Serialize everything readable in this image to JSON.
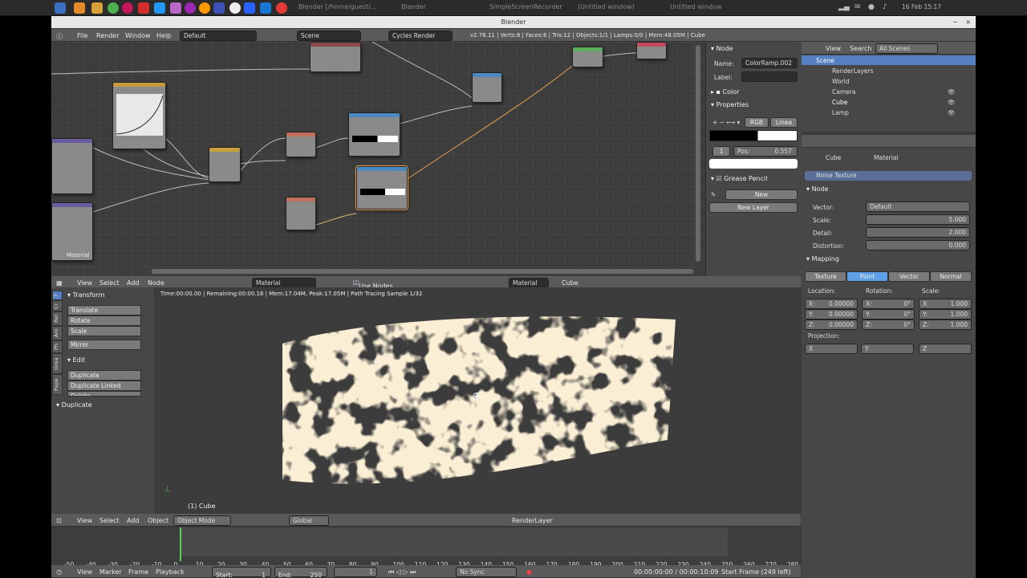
{
  "taskbar": {
    "tasks": [
      "Blender [/home/guest/...",
      "Blender",
      "SimpleScreenRecorder",
      "(Untitled window)",
      "Untitled window"
    ],
    "clock": "16 Feb 15:17"
  },
  "window": {
    "title": "Blender"
  },
  "infobar": {
    "menus": [
      "File",
      "Render",
      "Window",
      "Help"
    ],
    "layout": "Default",
    "scene": "Scene",
    "engine": "Cycles Render",
    "stats": "v2.76.11 | Verts:8 | Faces:6 | Tris:12 | Objects:1/1 | Lamps:0/0 | Mem:48.05M | Cube"
  },
  "node_editor": {
    "header_menus": [
      "View",
      "Select",
      "Add",
      "Node"
    ],
    "material": "Material",
    "use_nodes_label": "Use Nodes",
    "object": "Cube",
    "material_mode": "Material",
    "corner_label": "Material"
  },
  "node_panel": {
    "section_node": "Node",
    "name_label": "Name:",
    "name_value": "ColorRamp.002",
    "label_label": "Label:",
    "section_color": "Color",
    "section_properties": "Properties",
    "mode": "RGB",
    "interp": "Linea",
    "stop_index": "1",
    "pos_label": "Pos:",
    "pos_value": "0.557",
    "section_grease": "Grease Pencil",
    "new_label": "New",
    "new_layer_label": "New Layer"
  },
  "toolshelf": {
    "tabs": [
      "T",
      "Cr",
      "Rel",
      "Ani",
      "Ph",
      "Grea",
      "Pape"
    ],
    "section_transform": "Transform",
    "transform_items": [
      "Translate",
      "Rotate",
      "Scale"
    ],
    "mirror": "Mirror",
    "section_edit": "Edit",
    "edit_items": [
      "Duplicate",
      "Duplicate Linked",
      "Delete"
    ],
    "section_duplicate": "Duplicate"
  },
  "viewport": {
    "render_info": "Time:00:00.00 | Remaining:00:00.16 | Mem:17.04M, Peak:17.05M | Path Tracing Sample 1/32",
    "object_label": "(1) Cube",
    "header_menus": [
      "View",
      "Select",
      "Add",
      "Object"
    ],
    "mode": "Object Mode",
    "orientation": "Global",
    "render_layer": "RenderLayer"
  },
  "timeline": {
    "ticks": [
      "-50",
      "-40",
      "-30",
      "-20",
      "-10",
      "0",
      "10",
      "20",
      "30",
      "40",
      "50",
      "60",
      "70",
      "80",
      "90",
      "100",
      "110",
      "120",
      "130",
      "140",
      "150",
      "160",
      "170",
      "180",
      "190",
      "200",
      "210",
      "220",
      "230",
      "240",
      "250",
      "260",
      "270",
      "280"
    ],
    "menus": [
      "View",
      "Marker",
      "Frame",
      "Playback"
    ],
    "start_label": "Start:",
    "start": "1",
    "end_label": "End:",
    "end": "250",
    "current": "1",
    "sync": "No Sync",
    "time": "00:00:00:00 / 00:00:10:09",
    "status": "Start Frame (249 left)"
  },
  "outliner": {
    "menus": [
      "View",
      "Search"
    ],
    "filter": "All Scenes",
    "items": [
      "Scene",
      "RenderLayers",
      "World",
      "Camera",
      "Cube",
      "Lamp"
    ]
  },
  "properties": {
    "breadcrumb_object": "Cube",
    "breadcrumb_material": "Material",
    "texture_name": "Noise Texture",
    "section_node": "Node",
    "vector_label": "Vector:",
    "vector_value": "Default",
    "scale_label": "Scale:",
    "scale_value": "5.000",
    "detail_label": "Detail:",
    "detail_value": "2.000",
    "distortion_label": "Distortion:",
    "distortion_value": "0.000",
    "section_mapping": "Mapping",
    "mapping_tabs": [
      "Texture",
      "Point",
      "Vector",
      "Normal"
    ],
    "location_label": "Location:",
    "rotation_label": "Rotation:",
    "scale2_label": "Scale:",
    "loc": [
      "X:",
      "0.00000",
      "Y:",
      "0.00000",
      "Z:",
      "0.00000"
    ],
    "rot": [
      "X:",
      "0°",
      "Y:",
      "0°",
      "Z:",
      "0°"
    ],
    "scl": [
      "X:",
      "1.000",
      "Y:",
      "1.000",
      "Z:",
      "1.000"
    ],
    "projection_label": "Projection:",
    "proj": [
      "X",
      "Y",
      "Z"
    ]
  },
  "colors": {
    "accent": "#5680c2",
    "selected": "#5ea0e8"
  }
}
